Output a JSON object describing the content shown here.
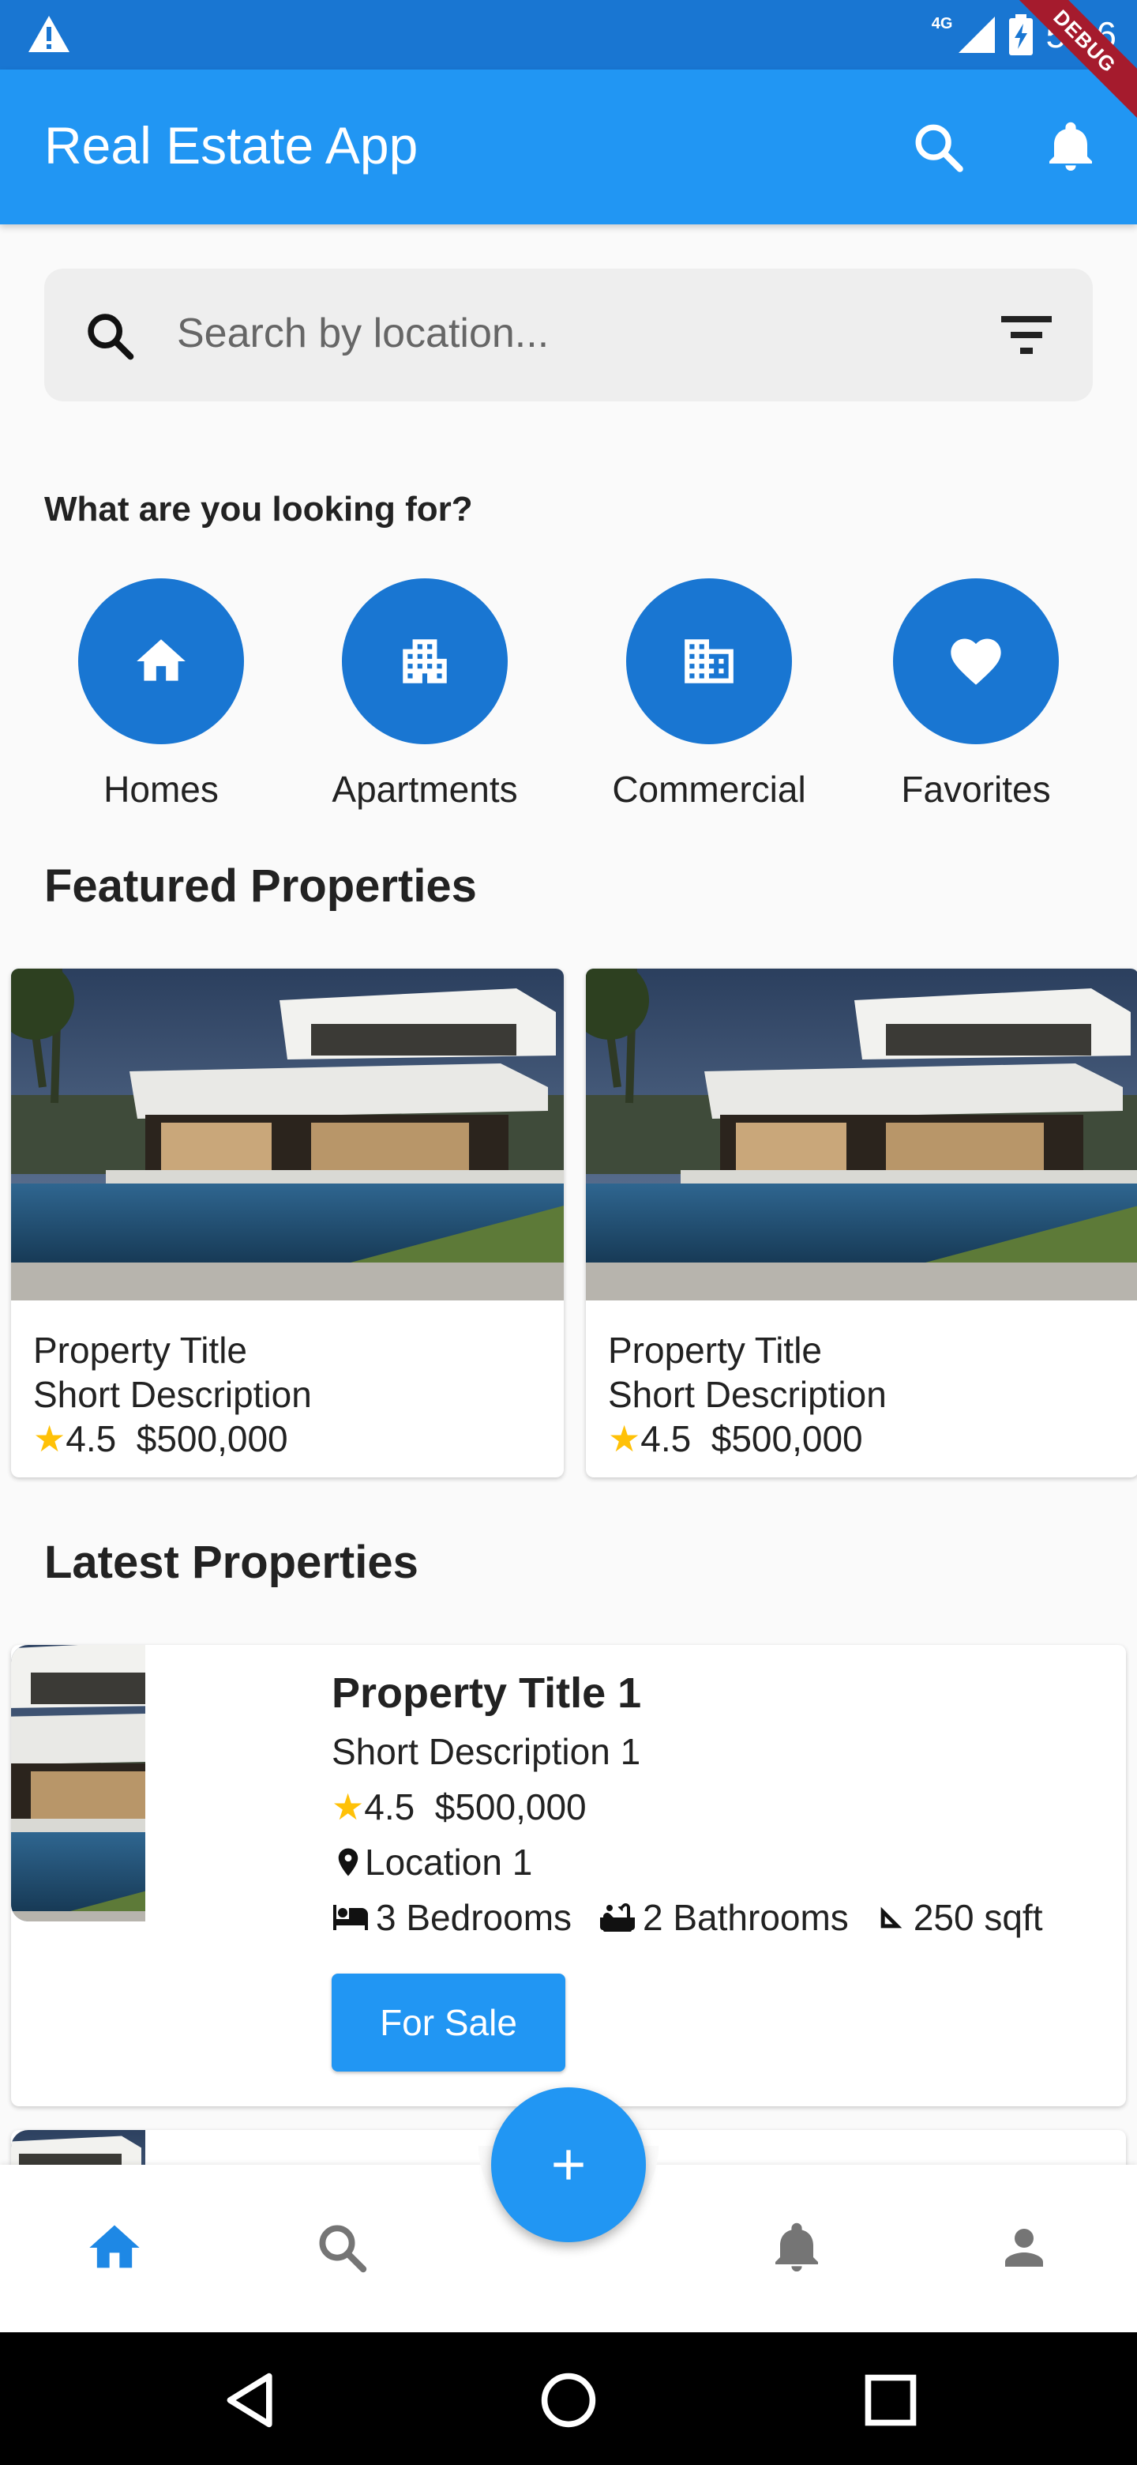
{
  "status_bar": {
    "time": "5:06",
    "network": "4G",
    "debug_label": "DEBUG"
  },
  "app_bar": {
    "title": "Real Estate App"
  },
  "search": {
    "placeholder": "Search by location..."
  },
  "categories": {
    "heading": "What are you looking for?",
    "items": [
      {
        "label": "Homes",
        "icon": "home-icon"
      },
      {
        "label": "Apartments",
        "icon": "apartment-icon"
      },
      {
        "label": "Commercial",
        "icon": "commercial-icon"
      },
      {
        "label": "Favorites",
        "icon": "heart-icon"
      }
    ]
  },
  "featured": {
    "heading": "Featured Properties",
    "cards": [
      {
        "title": "Property Title",
        "description": "Short Description",
        "rating": "4.5",
        "price": "$500,000"
      },
      {
        "title": "Property Title",
        "description": "Short Description",
        "rating": "4.5",
        "price": "$500,000"
      }
    ]
  },
  "latest": {
    "heading": "Latest Properties",
    "items": [
      {
        "title": "Property Title 1",
        "description": "Short Description 1",
        "rating": "4.5",
        "price": "$500,000",
        "location": "Location 1",
        "bedrooms": "3 Bedrooms",
        "bathrooms": "2 Bathrooms",
        "area": "250 sqft",
        "status": "For Sale"
      }
    ]
  },
  "bottom_nav": {
    "items": [
      "home-icon",
      "search-icon",
      "notifications-icon",
      "person-icon"
    ],
    "active": "home-icon",
    "fab_icon": "add-icon"
  },
  "colors": {
    "primary": "#2196f3",
    "primary_dark": "#1976d2",
    "star": "#ffc107"
  }
}
